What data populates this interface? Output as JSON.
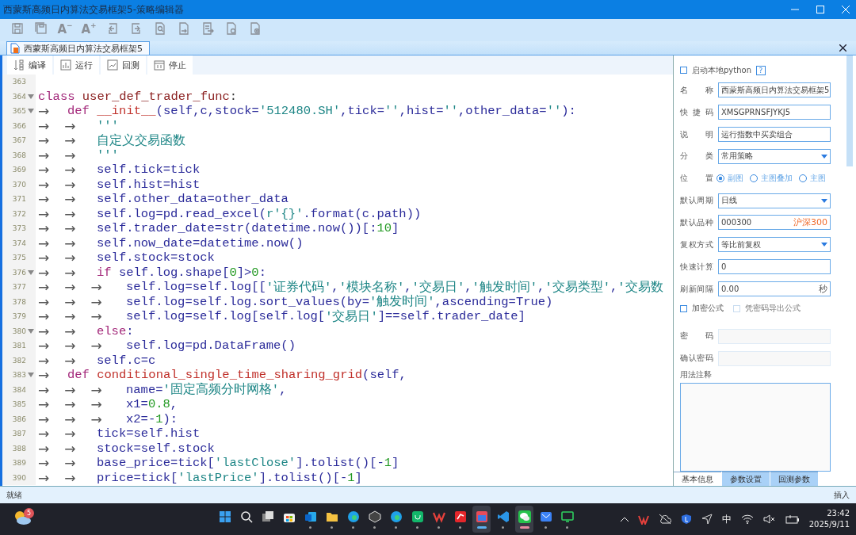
{
  "window": {
    "title": "西蒙斯高频日内算法交易框架5-策略编辑器"
  },
  "toolbar": [
    {
      "kind": "save"
    },
    {
      "kind": "save-all"
    },
    {
      "kind": "font",
      "label": "A",
      "mark": "−"
    },
    {
      "kind": "font",
      "label": "A",
      "mark": "+"
    },
    {
      "kind": "undo"
    },
    {
      "kind": "redo"
    },
    {
      "kind": "find"
    },
    {
      "kind": "export"
    },
    {
      "kind": "import"
    },
    {
      "kind": "doc-settings"
    },
    {
      "kind": "doc-add"
    }
  ],
  "document_tab": {
    "label": "西蒙斯高频日内算法交易框架5"
  },
  "editor_actions": [
    {
      "kind": "compile",
      "label": "编译"
    },
    {
      "kind": "run",
      "label": "运行"
    },
    {
      "kind": "backtest",
      "label": "回测"
    },
    {
      "kind": "stop",
      "label": "停止"
    }
  ],
  "code": [
    {
      "no": "363",
      "fold": false
    },
    {
      "no": "364",
      "fold": true,
      "tokens": [
        {
          "kind": "kw",
          "text": "class "
        },
        {
          "kind": "cls",
          "text": "user_def_trader_func"
        },
        {
          "kind": "op",
          "text": ":"
        }
      ]
    },
    {
      "no": "365",
      "fold": true,
      "indent": "→",
      "tokens": [
        {
          "kind": "kw",
          "text": "def "
        },
        {
          "kind": "fn",
          "text": "__init__"
        },
        {
          "kind": "id",
          "text": "(self,c,stock="
        },
        {
          "kind": "str",
          "text": "'512480.SH'"
        },
        {
          "kind": "id",
          "text": ",tick="
        },
        {
          "kind": "str",
          "text": "''"
        },
        {
          "kind": "id",
          "text": ",hist="
        },
        {
          "kind": "str",
          "text": "''"
        },
        {
          "kind": "id",
          "text": ",other_data="
        },
        {
          "kind": "str",
          "text": "''"
        },
        {
          "kind": "id",
          "text": "):"
        }
      ]
    },
    {
      "no": "366",
      "fold": false,
      "indent": "→→",
      "tokens": [
        {
          "kind": "str",
          "text": "'''"
        }
      ]
    },
    {
      "no": "367",
      "fold": false,
      "indent": "→→",
      "tokens": [
        {
          "kind": "str",
          "text": "自定义交易函数"
        }
      ]
    },
    {
      "no": "368",
      "fold": false,
      "indent": "→→",
      "tokens": [
        {
          "kind": "str",
          "text": "'''"
        }
      ]
    },
    {
      "no": "369",
      "fold": false,
      "indent": "→→",
      "tokens": [
        {
          "kind": "id",
          "text": "self.tick=tick"
        }
      ]
    },
    {
      "no": "370",
      "fold": false,
      "indent": "→→",
      "tokens": [
        {
          "kind": "id",
          "text": "self.hist=hist"
        }
      ]
    },
    {
      "no": "371",
      "fold": false,
      "indent": "→→",
      "tokens": [
        {
          "kind": "id",
          "text": "self.other_data=other_data"
        }
      ]
    },
    {
      "no": "372",
      "fold": false,
      "indent": "→→",
      "tokens": [
        {
          "kind": "id",
          "text": "self.log=pd.read_excel("
        },
        {
          "kind": "str",
          "text": "r'{}'"
        },
        {
          "kind": "id",
          "text": ".format(c.path))"
        }
      ]
    },
    {
      "no": "373",
      "fold": false,
      "indent": "→→",
      "tokens": [
        {
          "kind": "id",
          "text": "self.trader_date=str(datetime.now())[:"
        },
        {
          "kind": "num",
          "text": "10"
        },
        {
          "kind": "id",
          "text": "]"
        }
      ]
    },
    {
      "no": "374",
      "fold": false,
      "indent": "→→",
      "tokens": [
        {
          "kind": "id",
          "text": "self.now_date=datetime.now()"
        }
      ]
    },
    {
      "no": "375",
      "fold": false,
      "indent": "→→",
      "tokens": [
        {
          "kind": "id",
          "text": "self.stock=stock"
        }
      ]
    },
    {
      "no": "376",
      "fold": true,
      "indent": "→→",
      "tokens": [
        {
          "kind": "kw",
          "text": "if "
        },
        {
          "kind": "id",
          "text": "self.log.shape["
        },
        {
          "kind": "num",
          "text": "0"
        },
        {
          "kind": "id",
          "text": "]>"
        },
        {
          "kind": "num",
          "text": "0"
        },
        {
          "kind": "id",
          "text": ":"
        }
      ]
    },
    {
      "no": "377",
      "fold": false,
      "indent": "→→→",
      "tokens": [
        {
          "kind": "id",
          "text": "self.log=self.log[["
        },
        {
          "kind": "str",
          "text": "'证券代码'"
        },
        {
          "kind": "id",
          "text": ","
        },
        {
          "kind": "str",
          "text": "'模块名称'"
        },
        {
          "kind": "id",
          "text": ","
        },
        {
          "kind": "str",
          "text": "'交易日'"
        },
        {
          "kind": "id",
          "text": ","
        },
        {
          "kind": "str",
          "text": "'触发时间'"
        },
        {
          "kind": "id",
          "text": ","
        },
        {
          "kind": "str",
          "text": "'交易类型'"
        },
        {
          "kind": "id",
          "text": ","
        },
        {
          "kind": "str",
          "text": "'交易数"
        }
      ]
    },
    {
      "no": "378",
      "fold": false,
      "indent": "→→→",
      "tokens": [
        {
          "kind": "id",
          "text": "self.log=self.log.sort_values(by="
        },
        {
          "kind": "str",
          "text": "'触发时间'"
        },
        {
          "kind": "id",
          "text": ",ascending=True)"
        }
      ]
    },
    {
      "no": "379",
      "fold": false,
      "indent": "→→→",
      "tokens": [
        {
          "kind": "id",
          "text": "self.log=self.log[self.log["
        },
        {
          "kind": "str",
          "text": "'交易日'"
        },
        {
          "kind": "id",
          "text": "]==self.trader_date]"
        }
      ]
    },
    {
      "no": "380",
      "fold": true,
      "indent": "→→",
      "tokens": [
        {
          "kind": "kw",
          "text": "else"
        },
        {
          "kind": "id",
          "text": ":"
        }
      ]
    },
    {
      "no": "381",
      "fold": false,
      "indent": "→→→",
      "tokens": [
        {
          "kind": "id",
          "text": "self.log=pd.DataFrame()"
        }
      ]
    },
    {
      "no": "382",
      "fold": false,
      "indent": "→→",
      "tokens": [
        {
          "kind": "id",
          "text": "self.c=c"
        }
      ]
    },
    {
      "no": "383",
      "fold": true,
      "indent": "→",
      "tokens": [
        {
          "kind": "kw",
          "text": "def "
        },
        {
          "kind": "fn",
          "text": "conditional_single_time_sharing_grid"
        },
        {
          "kind": "id",
          "text": "(self,"
        }
      ]
    },
    {
      "no": "384",
      "fold": false,
      "indent": "→→→",
      "tokens": [
        {
          "kind": "id",
          "text": "name="
        },
        {
          "kind": "str",
          "text": "'固定高频分时网格'"
        },
        {
          "kind": "id",
          "text": ","
        }
      ]
    },
    {
      "no": "385",
      "fold": false,
      "indent": "→→→",
      "tokens": [
        {
          "kind": "id",
          "text": "x1="
        },
        {
          "kind": "num",
          "text": "0.8"
        },
        {
          "kind": "id",
          "text": ","
        }
      ]
    },
    {
      "no": "386",
      "fold": false,
      "indent": "→→→",
      "tokens": [
        {
          "kind": "id",
          "text": "x2=-"
        },
        {
          "kind": "num",
          "text": "1"
        },
        {
          "kind": "id",
          "text": "):"
        }
      ]
    },
    {
      "no": "387",
      "fold": false,
      "indent": "→→",
      "tokens": [
        {
          "kind": "id",
          "text": "tick=self.hist"
        }
      ]
    },
    {
      "no": "388",
      "fold": false,
      "indent": "→→",
      "tokens": [
        {
          "kind": "id",
          "text": "stock=self.stock"
        }
      ]
    },
    {
      "no": "389",
      "fold": false,
      "indent": "→→",
      "tokens": [
        {
          "kind": "id",
          "text": "base_price=tick["
        },
        {
          "kind": "str",
          "text": "'lastClose'"
        },
        {
          "kind": "id",
          "text": "].tolist()[-"
        },
        {
          "kind": "num",
          "text": "1"
        },
        {
          "kind": "id",
          "text": "]"
        }
      ]
    },
    {
      "no": "390",
      "fold": false,
      "indent": "→→",
      "tokens": [
        {
          "kind": "id",
          "text": "price=tick["
        },
        {
          "kind": "str",
          "text": "'lastPrice'"
        },
        {
          "kind": "id",
          "text": "].tolist()[-"
        },
        {
          "kind": "num",
          "text": "1"
        },
        {
          "kind": "id",
          "text": "]"
        }
      ]
    }
  ],
  "panel": {
    "local_python": {
      "label": "启动本地python",
      "checked": false
    },
    "fields": [
      {
        "kind": "text",
        "label": "名称",
        "value": "西蒙斯高频日内算法交易框架5"
      },
      {
        "kind": "text",
        "label": "快捷码",
        "value": "XMSGPRNSFJYKJ5"
      },
      {
        "kind": "text",
        "label": "说明",
        "value": "运行指数中买卖组合"
      },
      {
        "kind": "select",
        "label": "分类",
        "value": "常用策略"
      },
      {
        "kind": "radio",
        "label": "位置",
        "options": [
          {
            "label": "副图",
            "selected": true
          },
          {
            "label": "主图叠加",
            "selected": false
          },
          {
            "label": "主图",
            "selected": false
          }
        ]
      },
      {
        "kind": "select",
        "label": "默认周期",
        "value": "日线"
      },
      {
        "kind": "text",
        "label": "默认品种",
        "value": "000300",
        "suffix": {
          "text": "沪深300",
          "kind": "name"
        }
      },
      {
        "kind": "select",
        "label": "复权方式",
        "value": "等比前复权"
      },
      {
        "kind": "text",
        "label": "快速计算",
        "value": "0"
      },
      {
        "kind": "text",
        "label": "刷新间隔",
        "value": "0.00",
        "suffix": {
          "text": "秒",
          "kind": "unit"
        }
      },
      {
        "kind": "checks",
        "options": [
          {
            "label": "加密公式",
            "checked": false,
            "disabled": false
          },
          {
            "label": "凭密码导出公式",
            "checked": false,
            "disabled": true
          }
        ]
      },
      {
        "kind": "password",
        "label": "密码",
        "disabled": true
      },
      {
        "kind": "password",
        "label": "确认密码",
        "disabled": true
      },
      {
        "kind": "textarea",
        "label": "用法注释"
      }
    ],
    "tabs": [
      {
        "label": "基本信息",
        "selected": true
      },
      {
        "label": "参数设置",
        "selected": false
      },
      {
        "label": "回测参数",
        "selected": false
      }
    ],
    "help": "?"
  },
  "status_bar": {
    "left": "就绪",
    "right": "插入"
  },
  "taskbar": {
    "weather_badge": "5",
    "apps": [
      {
        "kind": "start",
        "running": false,
        "active": false
      },
      {
        "kind": "search",
        "running": false,
        "active": false
      },
      {
        "kind": "taskview",
        "running": false,
        "active": false
      },
      {
        "kind": "store",
        "running": false,
        "active": false
      },
      {
        "kind": "mail-blue",
        "running": true,
        "active": false
      },
      {
        "kind": "folder",
        "running": true,
        "active": false
      },
      {
        "kind": "browser",
        "running": true,
        "active": false
      },
      {
        "kind": "cube",
        "running": true,
        "active": false
      },
      {
        "kind": "browser",
        "running": true,
        "active": false
      },
      {
        "kind": "bag",
        "running": true,
        "active": false
      },
      {
        "kind": "wps",
        "running": true,
        "active": false
      },
      {
        "kind": "red-app",
        "running": true,
        "active": false
      },
      {
        "kind": "chart-app",
        "running": true,
        "active": true
      },
      {
        "kind": "code",
        "running": true,
        "active": false
      },
      {
        "kind": "chat",
        "running": true,
        "active": true
      },
      {
        "kind": "mail",
        "running": true,
        "active": false
      },
      {
        "kind": "screen",
        "running": true,
        "active": false
      }
    ],
    "ime": "中",
    "time": "23:42",
    "date": "2025/9/11"
  }
}
